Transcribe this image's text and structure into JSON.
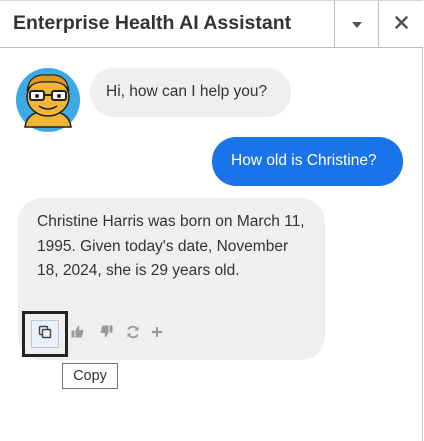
{
  "header": {
    "title": "Enterprise Health AI Assistant",
    "dropdown_icon": "caret-down-icon",
    "close_icon": "close-icon"
  },
  "messages": [
    {
      "role": "assistant",
      "text": "Hi, how can I help you?"
    },
    {
      "role": "user",
      "text": "How old is Christine?"
    },
    {
      "role": "assistant",
      "text": "Christine Harris was born on March 11, 1995. Given today's date, November 18, 2024, she is 29 years old."
    }
  ],
  "actions": {
    "copy_icon": "copy-icon",
    "thumbs_up_icon": "thumbs-up-icon",
    "thumbs_down_icon": "thumbs-down-icon",
    "regenerate_icon": "refresh-icon",
    "add_icon": "plus-icon"
  },
  "tooltip": {
    "text": "Copy"
  },
  "colors": {
    "user_bubble": "#1a73e8",
    "assistant_bubble": "#efefef",
    "avatar_face": "#f2b53a",
    "avatar_bg": "#3fa9e6"
  }
}
